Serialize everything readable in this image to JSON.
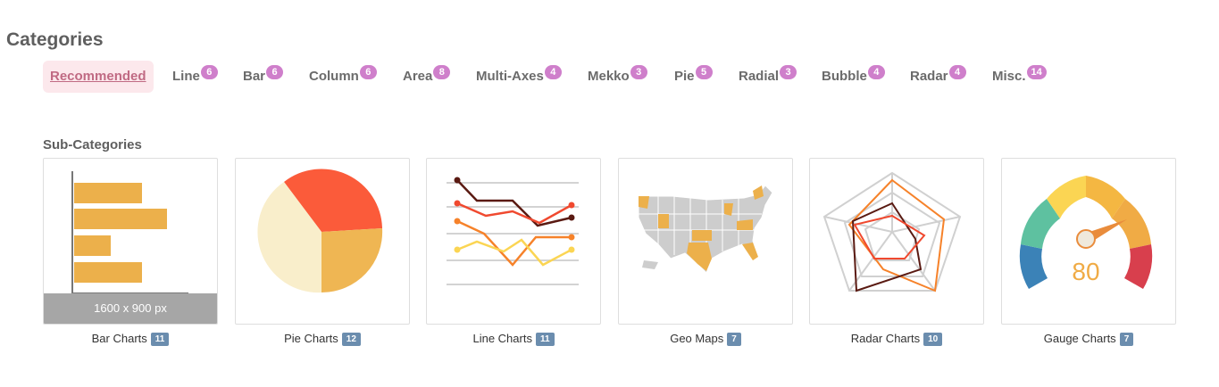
{
  "page": {
    "title": "Categories",
    "subtitle": "Sub-Categories"
  },
  "tabs": [
    {
      "label": "Recommended",
      "count": ""
    },
    {
      "label": "Line",
      "count": "6"
    },
    {
      "label": "Bar",
      "count": "6"
    },
    {
      "label": "Column",
      "count": "6"
    },
    {
      "label": "Area",
      "count": "8"
    },
    {
      "label": "Multi-Axes",
      "count": "4"
    },
    {
      "label": "Mekko",
      "count": "3"
    },
    {
      "label": "Pie",
      "count": "5"
    },
    {
      "label": "Radial",
      "count": "3"
    },
    {
      "label": "Bubble",
      "count": "4"
    },
    {
      "label": "Radar",
      "count": "4"
    },
    {
      "label": "Misc.",
      "count": "14"
    }
  ],
  "cards": [
    {
      "label": "Bar Charts",
      "count": "11",
      "dimension": "1600 x 900 px"
    },
    {
      "label": "Pie Charts",
      "count": "12"
    },
    {
      "label": "Line Charts",
      "count": "11"
    },
    {
      "label": "Geo Maps",
      "count": "7"
    },
    {
      "label": "Radar Charts",
      "count": "10"
    },
    {
      "label": "Gauge Charts",
      "count": "7",
      "gauge_value": "80"
    }
  ],
  "colors": {
    "accent_badge": "#cf7fcb",
    "count_badge": "#6b8dae",
    "bar": "#ecb04b",
    "pie_red": "#fb5b3a",
    "pie_orange": "#efb653",
    "pie_cream": "#f9eecb",
    "line_dark": "#5a1a12",
    "line_red": "#f0492f",
    "line_orange": "#f6822a",
    "line_yellow": "#fbd553"
  }
}
